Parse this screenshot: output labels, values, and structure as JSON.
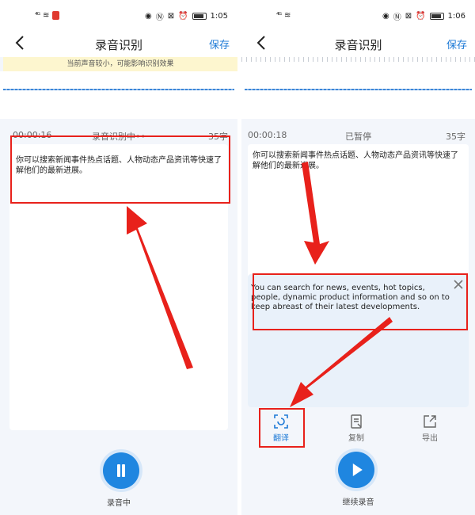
{
  "left": {
    "status": {
      "signal": "⁴ᴳ",
      "time": "1:05"
    },
    "nav": {
      "title": "录音识别",
      "save": "保存"
    },
    "warning": "当前声音较小，可能影响识别效果",
    "info": {
      "timer": "00:00:16",
      "state": "录音识别中••",
      "count": "35字"
    },
    "transcript": "你可以搜索新闻事件热点话题、人物动态产品资讯等快速了解他们的最新进展。",
    "record_label": "录音中"
  },
  "right": {
    "status": {
      "signal": "⁴ᴳ",
      "time": "1:06"
    },
    "nav": {
      "title": "录音识别",
      "save": "保存"
    },
    "info": {
      "timer": "00:00:18",
      "state": "已暂停",
      "count": "35字"
    },
    "transcript": "你可以搜索新闻事件热点话题、人物动态产品资讯等快速了解他们的最新进展。",
    "translation": "You can search for news, events, hot topics, people, dynamic product information and so on to keep abreast of their latest developments.",
    "toolbar": {
      "translate": "翻译",
      "copy": "复制",
      "export": "导出"
    },
    "continue_label": "继续录音"
  },
  "colors": {
    "accent": "#1e7ad6",
    "annotation": "#e8211b",
    "warning_bg": "#fdf6cf"
  }
}
